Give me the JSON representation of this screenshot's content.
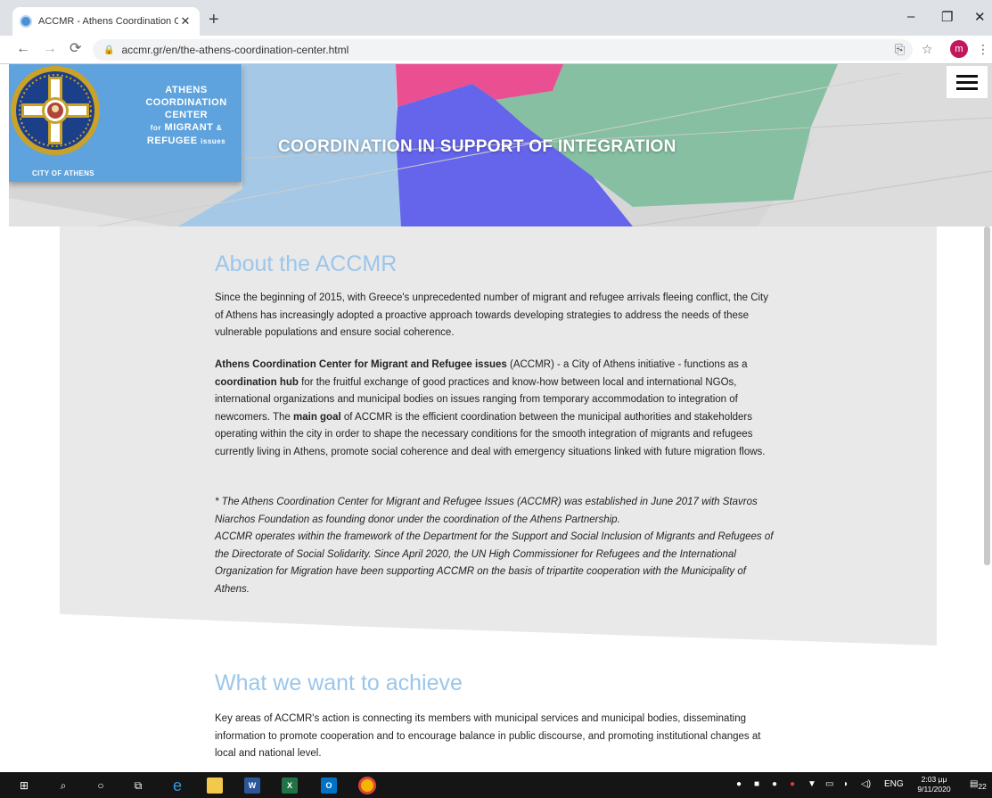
{
  "browser": {
    "tab_title": "ACCMR - Athens Coordination C",
    "tab_close": "✕",
    "new_tab": "+",
    "url": "accmr.gr/en/the-athens-coordination-center.html",
    "profile_initial": "m",
    "window_controls": {
      "minimize": "–",
      "restore": "❐",
      "close": "✕"
    }
  },
  "header": {
    "logo_lines": [
      "ATHENS",
      "COORDINATION",
      "CENTER"
    ],
    "logo_line_for": "for",
    "logo_line_migrant": "MIGRANT",
    "logo_line_amp": "&",
    "logo_line_refugee": "REFUGEE",
    "logo_line_issues": "issues",
    "city_label": "CITY OF ATHENS",
    "hero_title": "COORDINATION IN SUPPORT OF INTEGRATION",
    "brand_color": "#5ea3dd"
  },
  "about": {
    "heading": "About the ACCMR",
    "p1": "Since the beginning of 2015, with Greece's unprecedented number of migrant and refugee arrivals fleeing conflict, the City of Athens has increasingly adopted a proactive approach towards developing strategies to address the needs of these vulnerable populations and ensure social coherence.",
    "p2_bold_name": "Athens Coordination Center for Migrant and Refugee issues",
    "p2_a": " (ACCMR) - a City of Athens initiative - functions as a ",
    "p2_bold_hub": "coordination hub",
    "p2_b": " for the fruitful exchange of good practices and know-how between local and international NGOs, international organizations and municipal bodies on issues ranging from temporary accommodation to integration of newcomers. The ",
    "p2_bold_goal": "main goal",
    "p2_c": " of ACCMR is the efficient coordination between the municipal authorities and stakeholders operating within the city in order to shape the necessary conditions for the smooth integration of migrants and refugees currently living in Athens, promote social coherence and deal with emergency situations linked with future migration flows.",
    "note1": "* The Athens Coordination Center for Migrant and Refugee Issues (ACCMR) was established in June 2017 with Stavros Niarchos Foundation as founding donor under the coordination of the Athens Partnership.",
    "note2": "ACCMR operates within the framework of the Department for the Support and Social Inclusion of Migrants and Refugees of the Directorate of Social Solidarity. Since April 2020, the UN High Commissioner for Refugees and the International Organization for Migration have been supporting ACCMR on the basis of tripartite cooperation with the Municipality of Athens."
  },
  "achieve": {
    "heading": "What we want to achieve",
    "p1": "Key areas of ACCMR's action is connecting its members with municipal services and municipal bodies, disseminating information to promote cooperation and to encourage balance in public discourse, and promoting institutional changes at local and national level."
  },
  "taskbar": {
    "word_label": "W",
    "excel_label": "X",
    "outlook_label": "O",
    "lang": "ENG",
    "time": "2:03 μμ",
    "date": "9/11/2020",
    "notifications_badge": "22"
  }
}
